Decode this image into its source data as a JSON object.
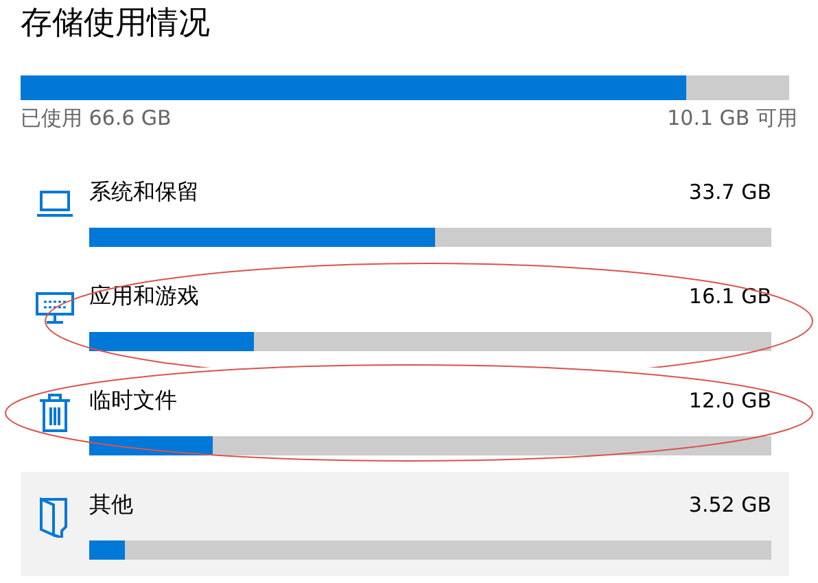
{
  "title": "存储使用情况",
  "total": {
    "level": 0.866,
    "used": "已使用 66.6 GB",
    "free": "10.1 GB 可用"
  },
  "categories": [
    {
      "kind": "laptop",
      "name": "系统和保留",
      "size": "33.7 GB",
      "level": 0.507,
      "selected": false,
      "circled": false
    },
    {
      "kind": "monitor",
      "name": "应用和游戏",
      "size": "16.1 GB",
      "level": 0.241,
      "selected": false,
      "circled": true
    },
    {
      "kind": "trash",
      "name": "临时文件",
      "size": "12.0 GB",
      "level": 0.181,
      "selected": false,
      "circled": true
    },
    {
      "kind": "folder",
      "name": "其他",
      "size": "3.52 GB",
      "level": 0.052,
      "selected": true,
      "circled": false
    }
  ]
}
